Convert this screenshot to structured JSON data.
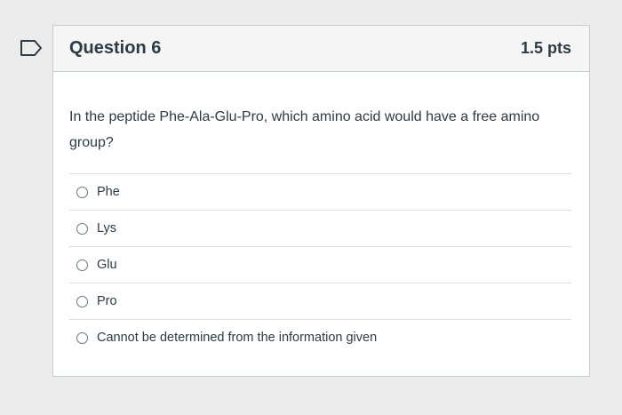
{
  "question": {
    "title": "Question 6",
    "points": "1.5 pts",
    "text": "In the peptide Phe-Ala-Glu-Pro, which amino acid would have a free amino group?",
    "answers": [
      {
        "label": "Phe"
      },
      {
        "label": "Lys"
      },
      {
        "label": "Glu"
      },
      {
        "label": "Pro"
      },
      {
        "label": "Cannot be determined from the information given"
      }
    ]
  },
  "colors": {
    "header_bg": "#f5f5f5",
    "border": "#c7cdd1",
    "text": "#2d3b45",
    "page_bg": "#ececec"
  },
  "icons": {
    "flag": "flag-icon"
  }
}
